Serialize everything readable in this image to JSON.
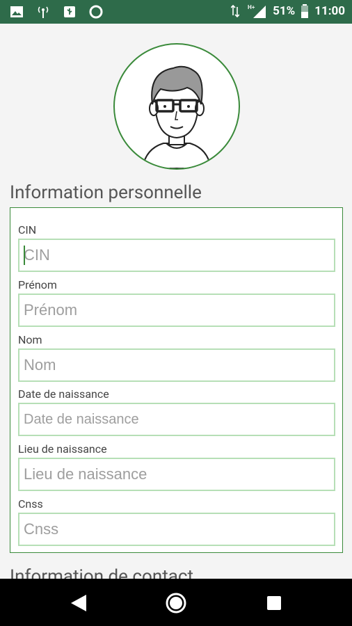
{
  "status_bar": {
    "battery": "51%",
    "time": "11:00",
    "network": "H+",
    "left_icons": [
      "image-icon",
      "broadcast-icon",
      "usb-icon",
      "circle-icon"
    ],
    "bg_color": "#2e6b4a"
  },
  "profile": {
    "avatar_icon": "user-avatar-glasses",
    "accent_color": "#3a8a3a"
  },
  "sections": {
    "personal": "Information personnelle",
    "contact": "Information de contact"
  },
  "fields": [
    {
      "label": "CIN",
      "placeholder": "CIN"
    },
    {
      "label": "Prénom",
      "placeholder": "Prénom"
    },
    {
      "label": "Nom",
      "placeholder": "Nom"
    },
    {
      "label": "Date de naissance",
      "placeholder": "Date de naissance"
    },
    {
      "label": "Lieu de naissance",
      "placeholder": "Lieu de naissance"
    },
    {
      "label": "Cnss",
      "placeholder": "Cnss"
    }
  ],
  "nav": {
    "back": "back-icon",
    "home": "home-icon",
    "recents": "recents-icon"
  }
}
